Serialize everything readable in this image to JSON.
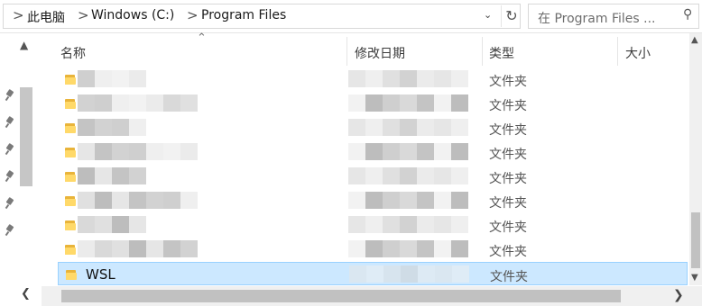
{
  "breadcrumb": {
    "items": [
      "此电脑",
      "Windows (C:)",
      "Program Files"
    ],
    "separator": ">"
  },
  "search": {
    "placeholder": "在 Program Files ..."
  },
  "columns": {
    "name": "名称",
    "modified": "修改日期",
    "type": "类型",
    "size": "大小"
  },
  "rows": [
    {
      "name": "",
      "type": "文件夹",
      "selected": false
    },
    {
      "name": "",
      "type": "文件夹",
      "selected": false
    },
    {
      "name": "",
      "type": "文件夹",
      "selected": false
    },
    {
      "name": "",
      "type": "文件夹",
      "selected": false
    },
    {
      "name": "",
      "type": "文件夹",
      "selected": false
    },
    {
      "name": "",
      "type": "文件夹",
      "selected": false
    },
    {
      "name": "",
      "type": "文件夹",
      "selected": false
    },
    {
      "name": "",
      "type": "文件夹",
      "selected": false
    },
    {
      "name": "WSL",
      "type": "文件夹",
      "selected": true
    }
  ],
  "colors": {
    "selection_bg": "#cce8ff",
    "selection_border": "#99d1ff",
    "folder": "#ffd969"
  }
}
